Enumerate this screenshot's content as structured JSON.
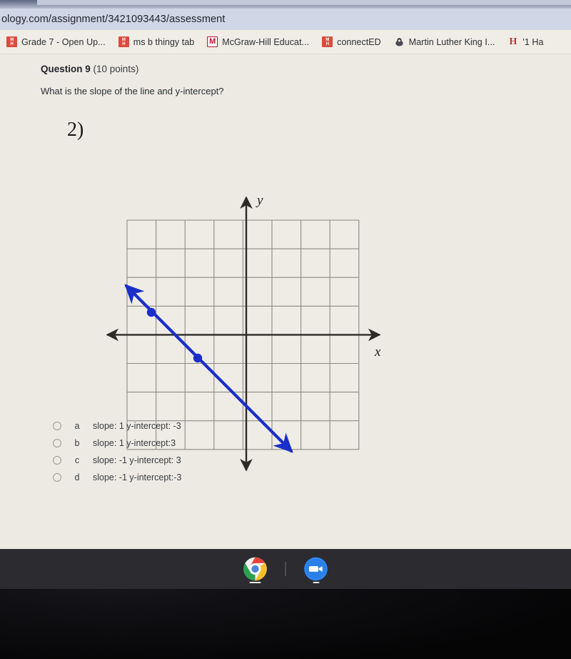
{
  "browser": {
    "url": "ology.com/assignment/3421093443/assessment",
    "bookmarks": [
      {
        "label": "Grade 7 - Open Up...",
        "icon": "openup-favicon",
        "icon_style": "fav-red2",
        "glyph": "OU"
      },
      {
        "label": "ms b thingy tab",
        "icon": "mcgraw-hill-favicon",
        "icon_style": "fav-red2",
        "glyph": "MH"
      },
      {
        "label": "McGraw-Hill Educat...",
        "icon": "mcgraw-hill-m-favicon",
        "icon_style": "fav-mcg",
        "glyph": "M"
      },
      {
        "label": "connectED",
        "icon": "connected-favicon",
        "icon_style": "fav-red2",
        "glyph": "CE"
      },
      {
        "label": "Martin Luther King I...",
        "icon": "school-crest-icon",
        "icon_style": "fav-mlk",
        "glyph": ""
      },
      {
        "label": "'1 Ha",
        "icon": "harvard-h-favicon",
        "icon_style": "fav-h",
        "glyph": "H"
      }
    ]
  },
  "assessment": {
    "question_label": "Question 9",
    "points": "(10 points)",
    "prompt": "What is the slope of the line and y-intercept?",
    "figure_number": "2)",
    "options": [
      {
        "letter": "a",
        "text": "slope: 1 y-intercept: -3"
      },
      {
        "letter": "b",
        "text": "slope: 1 y-intercept:3"
      },
      {
        "letter": "c",
        "text": "slope: -1 y-intercept: 3"
      },
      {
        "letter": "d",
        "text": "slope: -1 y-intercept:-3"
      }
    ]
  },
  "chart_data": {
    "type": "line",
    "title": "",
    "xlabel": "x",
    "ylabel": "y",
    "xlim": [
      -4,
      4
    ],
    "ylim": [
      -4,
      4
    ],
    "grid": true,
    "grid_step": 1,
    "axis_color": "#2e2a26",
    "line_color": "#1a2ec9",
    "point_color": "#1a2ec9",
    "legend": "none",
    "series": [
      {
        "name": "line",
        "slope": -1,
        "y_intercept": -3,
        "equation": "y = -x - 3",
        "endpoints": [
          [
            -4.2,
            1.7
          ],
          [
            1.55,
            -4.1
          ]
        ],
        "arrow_both_ends": true,
        "points": [
          [
            -3.3,
            0.8
          ],
          [
            -1.7,
            -0.8
          ]
        ]
      }
    ]
  },
  "dock": {
    "items": [
      {
        "name": "chrome-browser",
        "label": "Chrome"
      },
      {
        "name": "zoom-app",
        "label": "Zoom"
      }
    ]
  }
}
